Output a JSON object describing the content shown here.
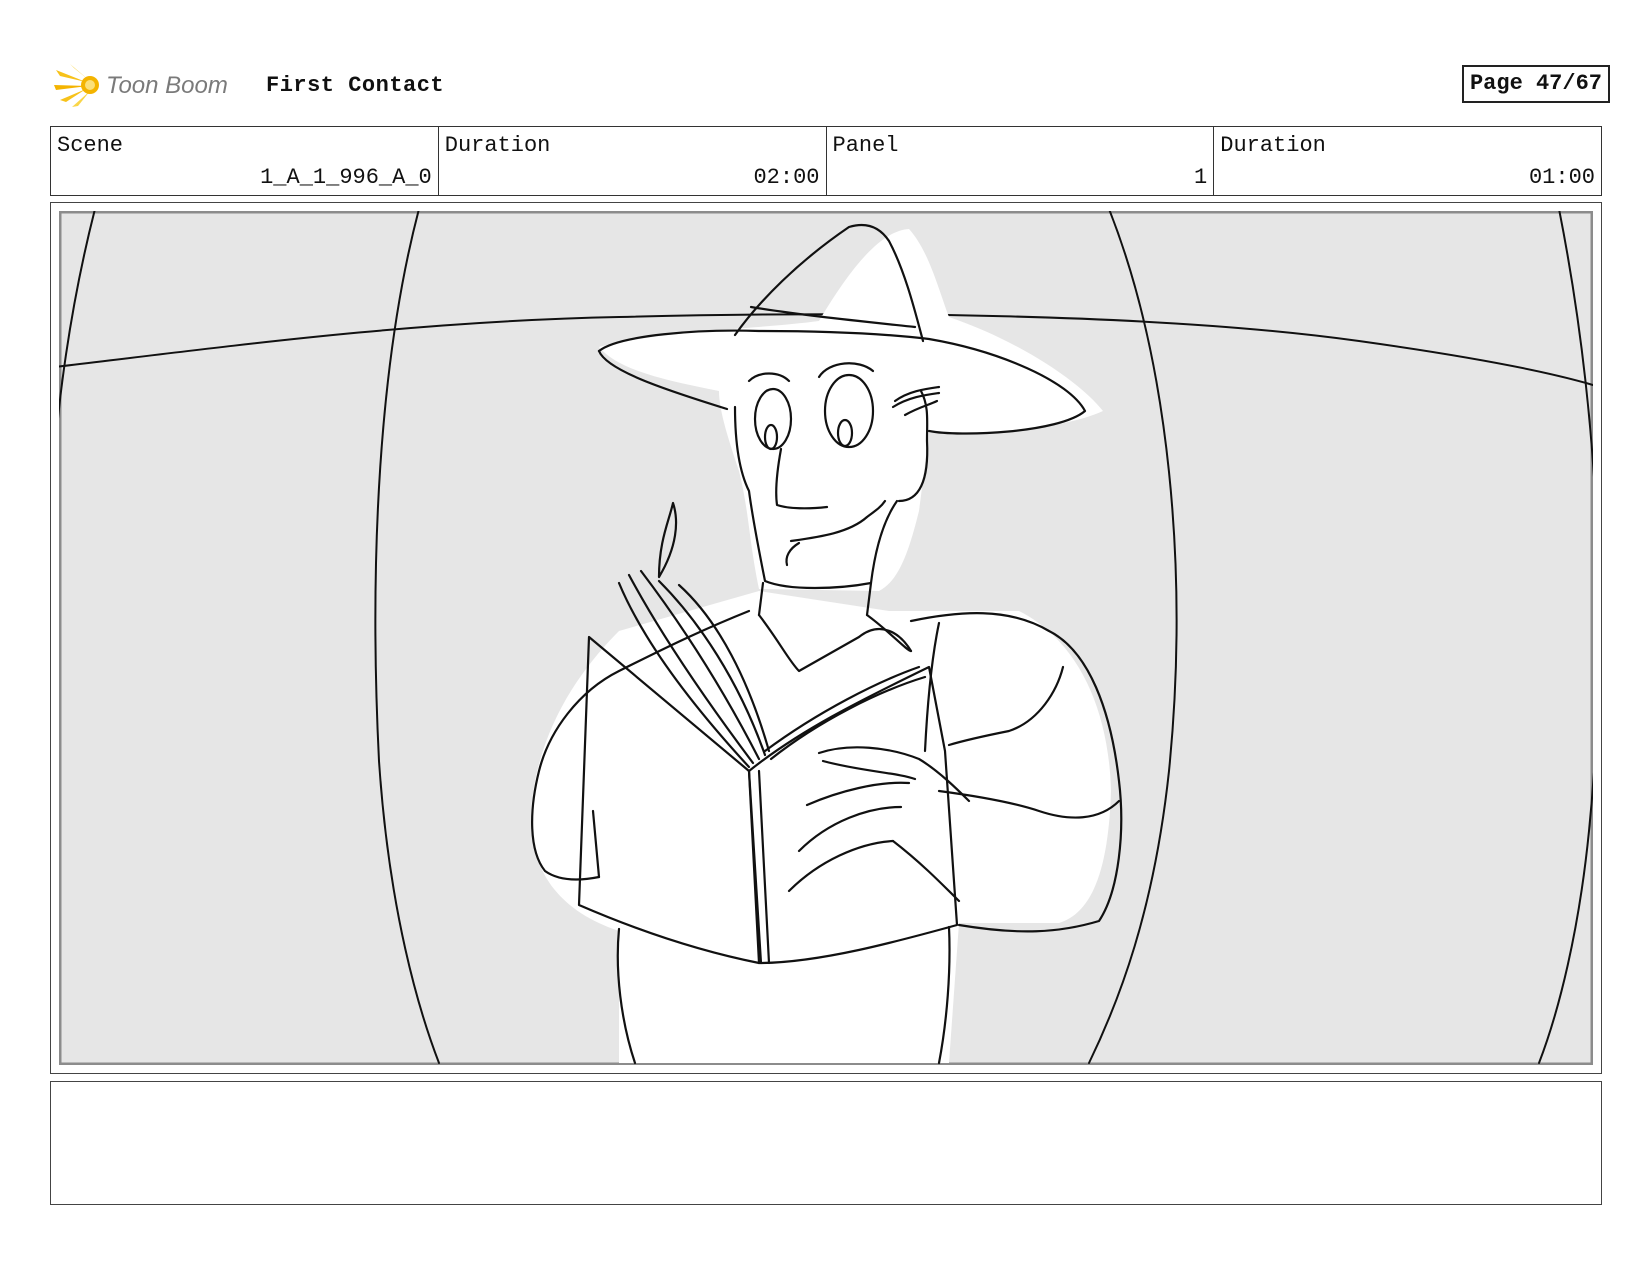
{
  "header": {
    "logo_text": "Toon Boom",
    "project_title": "First Contact",
    "page_label": "Page 47/67"
  },
  "info": {
    "scene_label": "Scene",
    "scene_value": "1_A_1_996_A_0",
    "scene_duration_label": "Duration",
    "scene_duration_value": "02:00",
    "panel_label": "Panel",
    "panel_value": "1",
    "panel_duration_label": "Duration",
    "panel_duration_value": "01:00"
  },
  "panel": {
    "image_name": "storyboard-sketch-man-reading-book"
  },
  "notes": {
    "text": ""
  },
  "colors": {
    "logo_flame": "#f4b400",
    "logo_text": "#777777",
    "frame_bg": "#e6e6e6",
    "line": "#111111"
  }
}
